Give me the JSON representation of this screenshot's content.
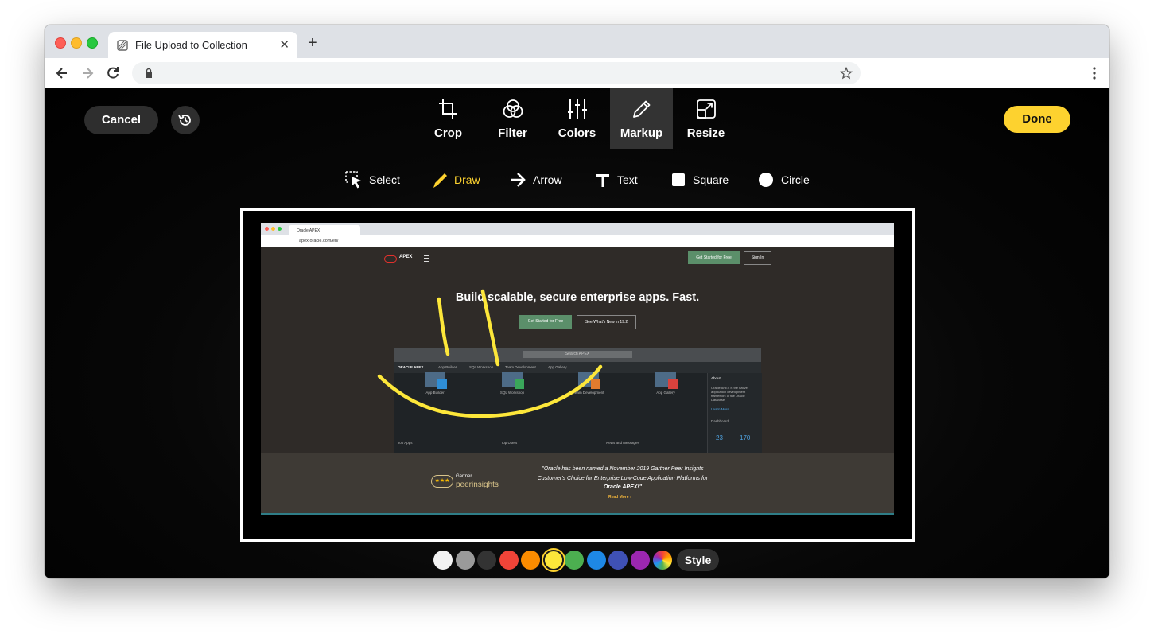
{
  "browser": {
    "tab_title": "File Upload to Collection",
    "tab_close": "✕",
    "new_tab": "+",
    "address": ""
  },
  "editor": {
    "cancel_label": "Cancel",
    "done_label": "Done",
    "tools": [
      {
        "label": "Crop",
        "icon": "crop-icon"
      },
      {
        "label": "Filter",
        "icon": "filter-icon"
      },
      {
        "label": "Colors",
        "icon": "sliders-icon"
      },
      {
        "label": "Markup",
        "icon": "pencil-icon",
        "active": true
      },
      {
        "label": "Resize",
        "icon": "resize-icon"
      }
    ],
    "markup_tools": [
      {
        "label": "Select",
        "icon": "select-cursor-icon"
      },
      {
        "label": "Draw",
        "icon": "draw-pencil-icon",
        "active": true
      },
      {
        "label": "Arrow",
        "icon": "arrow-right-icon"
      },
      {
        "label": "Text",
        "icon": "text-t-icon"
      },
      {
        "label": "Square",
        "icon": "square-icon"
      },
      {
        "label": "Circle",
        "icon": "circle-icon"
      }
    ],
    "palette": {
      "colors": [
        "#f2f2f2",
        "#9a9a9a",
        "#333333",
        "#f04438",
        "#fb8c00",
        "#fde73a",
        "#4caf50",
        "#1e88e5",
        "#3f51b5",
        "#9c27b0"
      ],
      "selected_index": 5,
      "style_label": "Style"
    }
  },
  "image": {
    "tab": "Oracle APEX",
    "url": "apex.oracle.com/en/",
    "brand": "APEX",
    "header_cta": "Get Started for Free",
    "sign_in": "Sign In",
    "headline": "Build scalable, secure enterprise apps. Fast.",
    "hero_cta": "Get Started for Free",
    "whats_new": "See What's New in 19.2",
    "mock_search": "Search APEX",
    "mock_nav": [
      "ORACLE APEX",
      "App Builder",
      "SQL Workshop",
      "Team Development",
      "App Gallery"
    ],
    "mock_tiles": [
      "App Builder",
      "SQL Workshop",
      "Team Development",
      "App Gallery"
    ],
    "mock_side_title": "About",
    "mock_side_text": "Oracle APEX is the native application development framework of the Oracle Database.",
    "mock_side_link": "Learn More...",
    "mock_side_dashboard": "Dashboard",
    "mock_stats": [
      "23",
      "170"
    ],
    "mock_bottom": [
      "Top Apps",
      "Top Users",
      "News and Messages"
    ],
    "gartner_word": "Gartner",
    "peer_insights": "peerinsights",
    "stars": "★★★",
    "quote_1": "\"Oracle has been named a November 2019 Gartner Peer Insights",
    "quote_2": "Customer's Choice for Enterprise Low-Code Application Platforms for",
    "quote_3": "Oracle APEX!\"",
    "read_more": "Read More ›"
  },
  "doodle_color": "#fde73a"
}
